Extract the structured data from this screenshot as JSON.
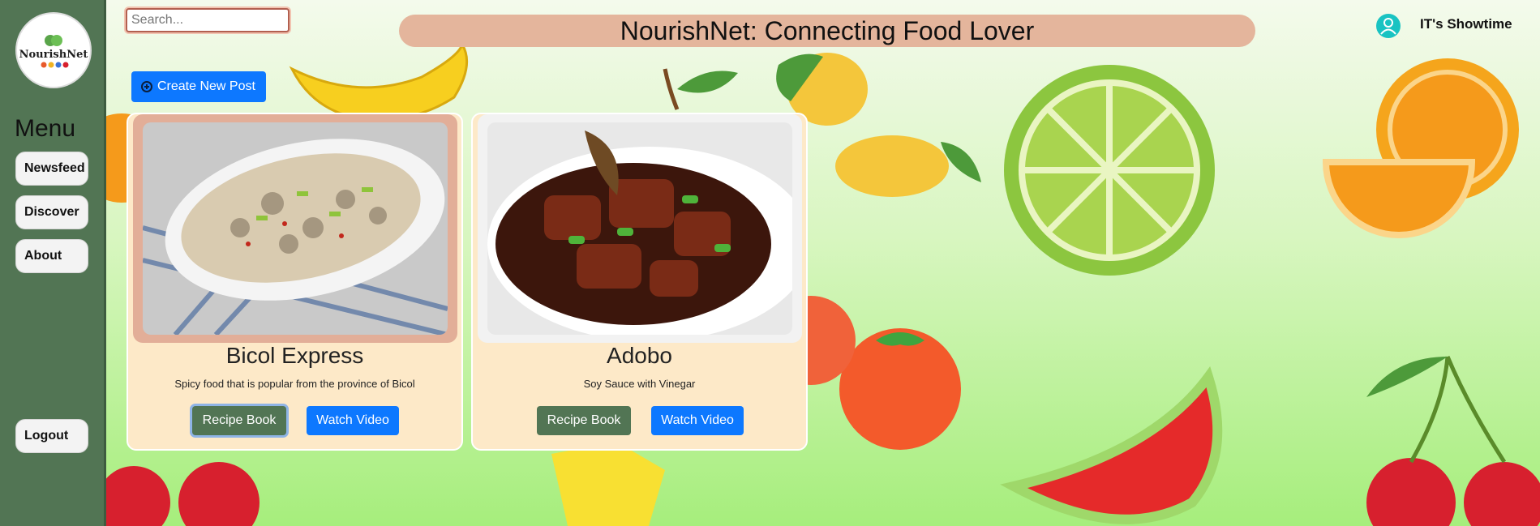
{
  "app": {
    "logo_text": "NourishNet",
    "header_title": "NourishNet: Connecting Food Lover",
    "user_name": "IT's Showtime"
  },
  "search": {
    "placeholder": "Search..."
  },
  "sidebar": {
    "menu_title": "Menu",
    "items": [
      {
        "label": "Newsfeed"
      },
      {
        "label": "Discover"
      },
      {
        "label": "About"
      }
    ],
    "logout_label": "Logout"
  },
  "toolbar": {
    "create_label": "Create New Post"
  },
  "posts": [
    {
      "title": "Bicol Express",
      "description": "Spicy food that is popular from the province of Bicol",
      "recipe_label": "Recipe Book",
      "video_label": "Watch Video"
    },
    {
      "title": "Adobo",
      "description": "Soy Sauce with Vinegar",
      "recipe_label": "Recipe Book",
      "video_label": "Watch Video"
    }
  ],
  "colors": {
    "sidebar": "#527554",
    "header": "#e4b59c",
    "primary": "#0d78ff",
    "card": "#fde9c8"
  }
}
